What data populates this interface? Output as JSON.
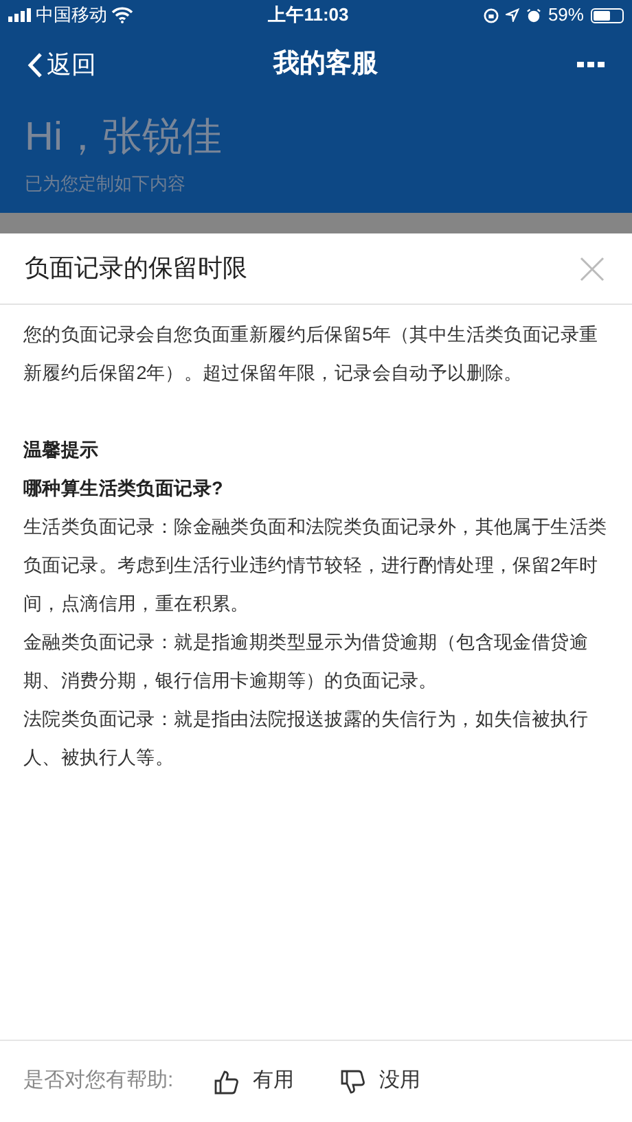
{
  "status_bar": {
    "carrier": "中国移动",
    "time": "上午11:03",
    "battery": "59%"
  },
  "nav": {
    "back": "返回",
    "title": "我的客服"
  },
  "greeting": {
    "title": "Hi，张锐佳",
    "subtitle": "已为您定制如下内容"
  },
  "dialog": {
    "title": "负面记录的保留时限",
    "paragraphs": [
      {
        "kind": "text",
        "text": "您的负面记录会自您负面重新履约后保留5年（其中生活类负面记录重新履约后保留2年）。超过保留年限，记录会自动予以删除。"
      },
      {
        "kind": "gap"
      },
      {
        "kind": "heading",
        "text": "温馨提示"
      },
      {
        "kind": "heading",
        "text": "哪种算生活类负面记录?"
      },
      {
        "kind": "text",
        "text": "生活类负面记录：除金融类负面和法院类负面记录外，其他属于生活类负面记录。考虑到生活行业违约情节较轻，进行酌情处理，保留2年时间，点滴信用，重在积累。"
      },
      {
        "kind": "text",
        "text": "金融类负面记录：就是指逾期类型显示为借贷逾期（包含现金借贷逾期、消费分期，银行信用卡逾期等）的负面记录。"
      },
      {
        "kind": "text",
        "text": "法院类负面记录：就是指由法院报送披露的失信行为，如失信被执行人、被执行人等。"
      }
    ]
  },
  "feedback": {
    "prompt": "是否对您有帮助:",
    "buttons": [
      {
        "kind": "like",
        "label": "有用"
      },
      {
        "kind": "dislike",
        "label": "没用"
      }
    ]
  }
}
